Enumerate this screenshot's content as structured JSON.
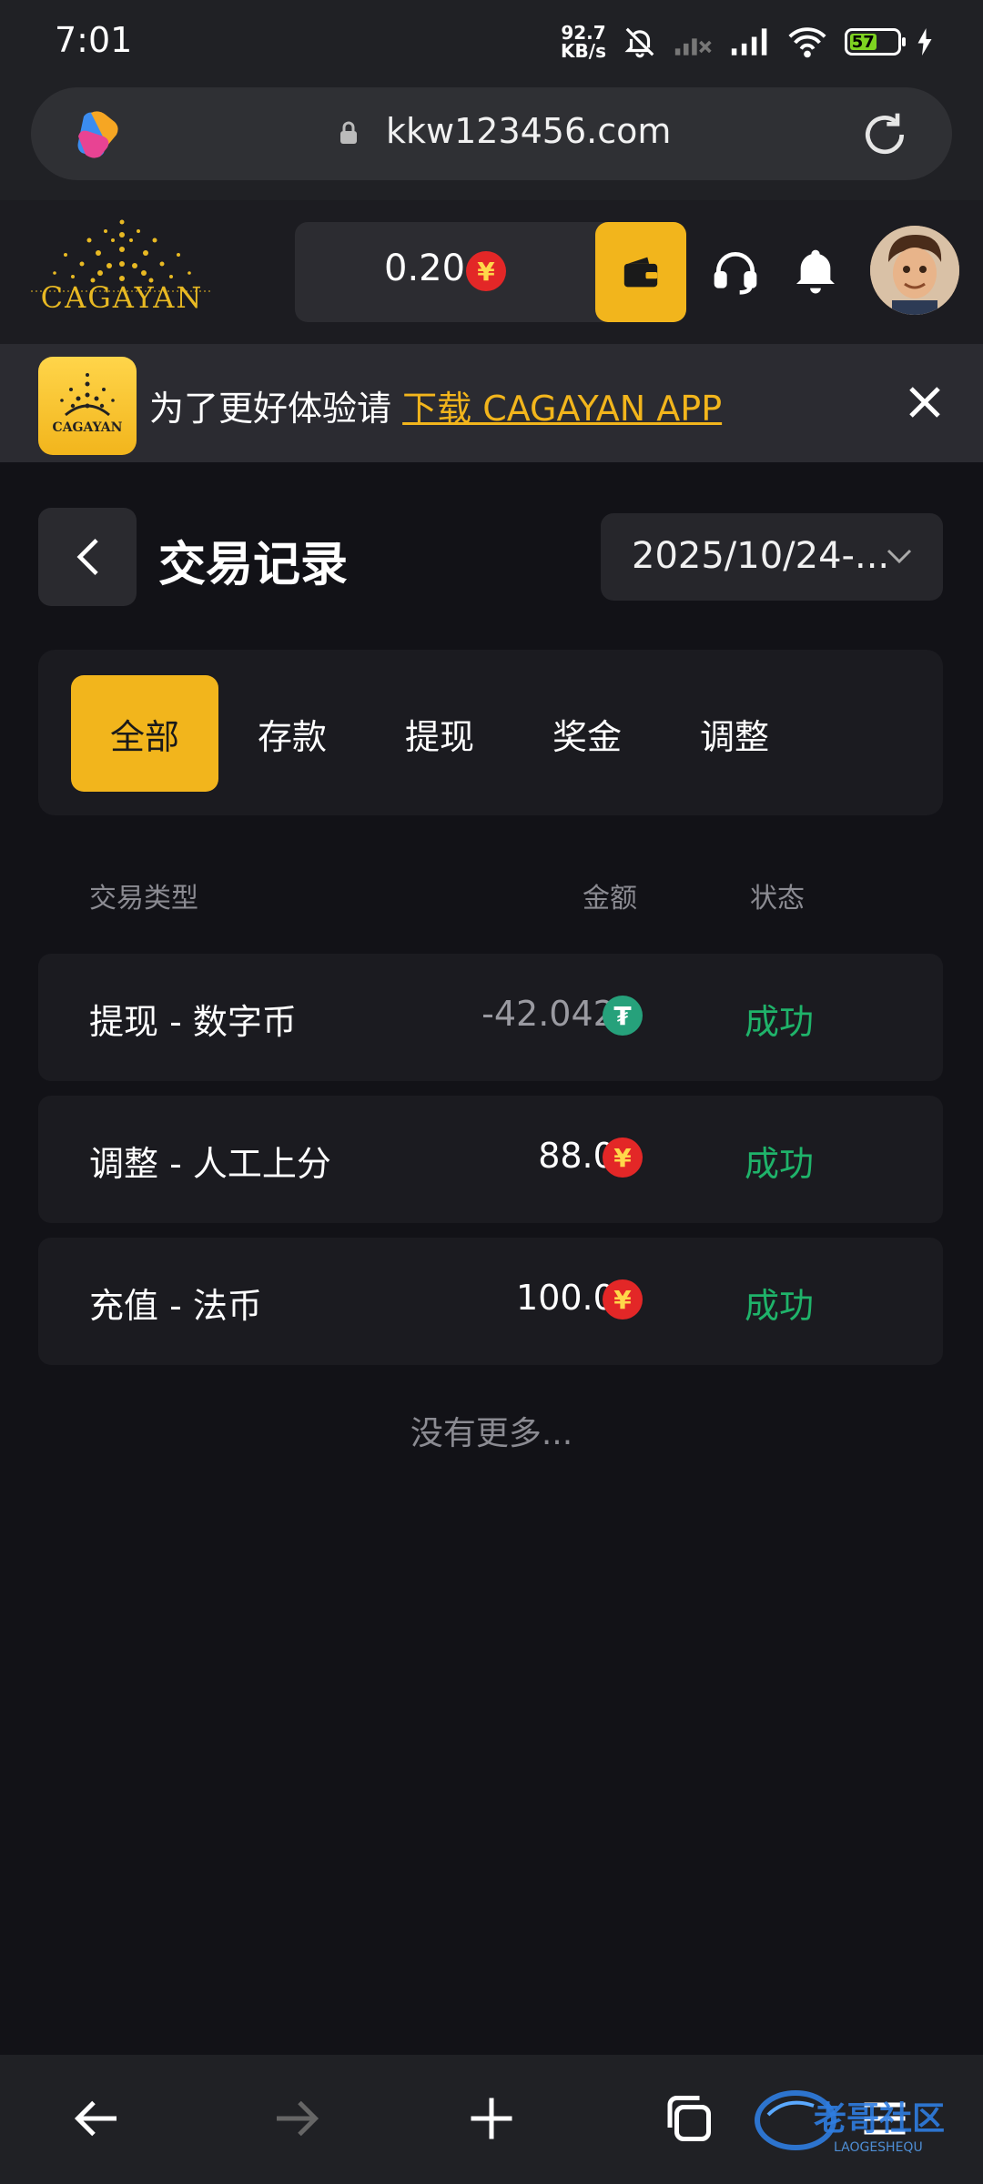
{
  "status_bar": {
    "time": "7:01",
    "net_speed_value": "92.7",
    "net_speed_unit": "KB/s",
    "battery": "57"
  },
  "browser": {
    "url": "kkw123456.com"
  },
  "header": {
    "logo_text": "CAGAYAN",
    "balance": "0.20",
    "currency_symbol": "¥"
  },
  "banner": {
    "app_icon_text": "CAGAYAN",
    "prefix": "为了更好体验请",
    "link": "下载 CAGAYAN APP"
  },
  "page": {
    "title": "交易记录",
    "date_range": "2025/10/24-..."
  },
  "tabs": [
    {
      "label": "全部",
      "active": true
    },
    {
      "label": "存款",
      "active": false
    },
    {
      "label": "提现",
      "active": false
    },
    {
      "label": "奖金",
      "active": false
    },
    {
      "label": "调整",
      "active": false
    }
  ],
  "table": {
    "headers": {
      "type": "交易类型",
      "amount": "金额",
      "status": "状态"
    },
    "rows": [
      {
        "type": "提现 - 数字币",
        "amount": "-42.0429",
        "currency": "tether-icon",
        "currency_symbol": "₮",
        "status": "成功"
      },
      {
        "type": "调整 - 人工上分",
        "amount": "88.00",
        "currency": "yuan-icon",
        "currency_symbol": "¥",
        "status": "成功"
      },
      {
        "type": "充值 - 法币",
        "amount": "100.00",
        "currency": "yuan-icon",
        "currency_symbol": "¥",
        "status": "成功"
      }
    ]
  },
  "footer_note": "没有更多...",
  "watermark": {
    "text": "老哥社区",
    "subtext": "LAOGESHEQU"
  },
  "colors": {
    "accent": "#f2b51c",
    "success": "#1fb36a",
    "background": "#121217",
    "card": "#1b1b20"
  }
}
